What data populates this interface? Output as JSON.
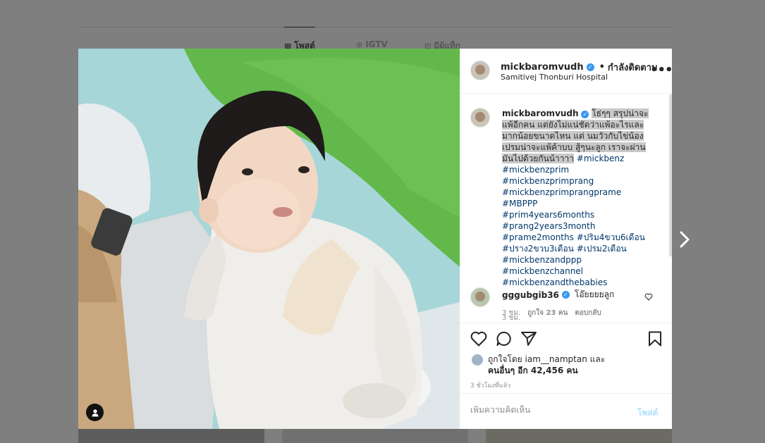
{
  "background": {
    "tabs": [
      {
        "label": "โพสต์",
        "icon": "grid-icon"
      },
      {
        "label": "IGTV",
        "icon": "igtv-icon"
      },
      {
        "label": "มีผู้แท็ก",
        "icon": "tagged-icon"
      }
    ]
  },
  "post": {
    "username": "mickbaromvudh",
    "separator": "•",
    "follow_label": "กำลังติดตาม",
    "location": "Samitivej Thonburi Hospital",
    "more_label": "•••",
    "caption": {
      "username": "mickbaromvudh",
      "text_selected": "โธ่ๆๆ สรุปน่าจะแพ้อีกคน แต่ยังไม่แน่ชัดว่าแพ้อะไรและมากน้อยขนาดไหน แต่ นมวัวกับไข่น้องเปรมน่าจะแพ้ค้าบบ สู้ๆนะลูก เราจะผ่านมันไปด้วยกันน้าาาา",
      "hashtags": [
        "#mickbenz",
        "#mickbenzprim",
        "#mickbenzprimprang",
        "#mickbenzprimprangprame",
        "#MBPPP",
        "#prim4years6months",
        "#prang2years3month",
        "#prame2months",
        "#ปริม4ขวบ6เดือน",
        "#ปราง2ขวบ3เดือน",
        "#เปรม2เดือน",
        "#mickbenzandppp",
        "#mickbenzchannel",
        "#mickbenzandthebabies"
      ],
      "time": "3 ชม."
    },
    "comments": [
      {
        "username": "gggubgib36",
        "text": "โอ๊ยยยยลูก",
        "time": "3 ชม.",
        "likes": "ถูกใจ 23 คน",
        "reply": "ตอบกลับ"
      }
    ],
    "liked_by_prefix": "ถูกใจโดย",
    "liked_by_user": "iam__namptan",
    "liked_by_and": "และ",
    "likes_others": "คนอื่นๆ อีก 42,456 คน",
    "time_ago": "3 ชั่วโมงที่แล้ว",
    "comment_placeholder": "เพิ่มความคิดเห็น",
    "post_button": "โพสต์"
  },
  "colors": {
    "link": "#00376b",
    "verified": "#3897f0",
    "post_disabled": "#b2dffc"
  }
}
